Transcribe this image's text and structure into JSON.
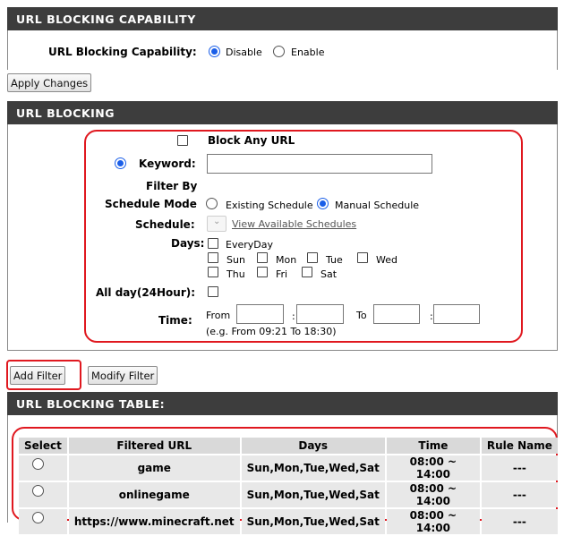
{
  "capability": {
    "header": "URL BLOCKING CAPABILITY",
    "label": "URL Blocking Capability:",
    "opt_disable": "Disable",
    "opt_enable": "Enable",
    "selected": "Disable",
    "apply_button": "Apply Changes"
  },
  "blocking": {
    "header": "URL BLOCKING",
    "block_any_url": "Block Any URL",
    "keyword_label": "Keyword:",
    "keyword_value": "",
    "filter_by": "Filter By",
    "schedule_mode_label": "Schedule Mode",
    "opt_existing": "Existing Schedule",
    "opt_manual": "Manual Schedule",
    "schedule_mode_selected": "Manual Schedule",
    "schedule_label": "Schedule:",
    "view_schedules_link": "View Available Schedules",
    "days_label": "Days:",
    "everyday": "EveryDay",
    "days": [
      "Sun",
      "Mon",
      "Tue",
      "Wed",
      "Thu",
      "Fri",
      "Sat"
    ],
    "allday_label": "All day(24Hour):",
    "time_label": "Time:",
    "from_label": "From",
    "to_label": "To",
    "colon": ":",
    "time_hint": "(e.g. From 09:21 To 18:30)",
    "add_button": "Add Filter",
    "modify_button": "Modify Filter"
  },
  "table": {
    "header": "URL BLOCKING TABLE:",
    "columns": [
      "Select",
      "Filtered URL",
      "Days",
      "Time",
      "Rule Name"
    ],
    "rows": [
      {
        "url": "game",
        "days": "Sun,Mon,Tue,Wed,Sat",
        "time": "08:00 ~ 14:00",
        "rule": "---"
      },
      {
        "url": "onlinegame",
        "days": "Sun,Mon,Tue,Wed,Sat",
        "time": "08:00 ~ 14:00",
        "rule": "---"
      },
      {
        "url": "https://www.minecraft.net",
        "days": "Sun,Mon,Tue,Wed,Sat",
        "time": "08:00 ~ 14:00",
        "rule": "---"
      }
    ]
  },
  "colors": {
    "header_bar": "#3d3d3d",
    "radio_accent": "#1a5ee8",
    "highlight_red": "#e0181f"
  }
}
